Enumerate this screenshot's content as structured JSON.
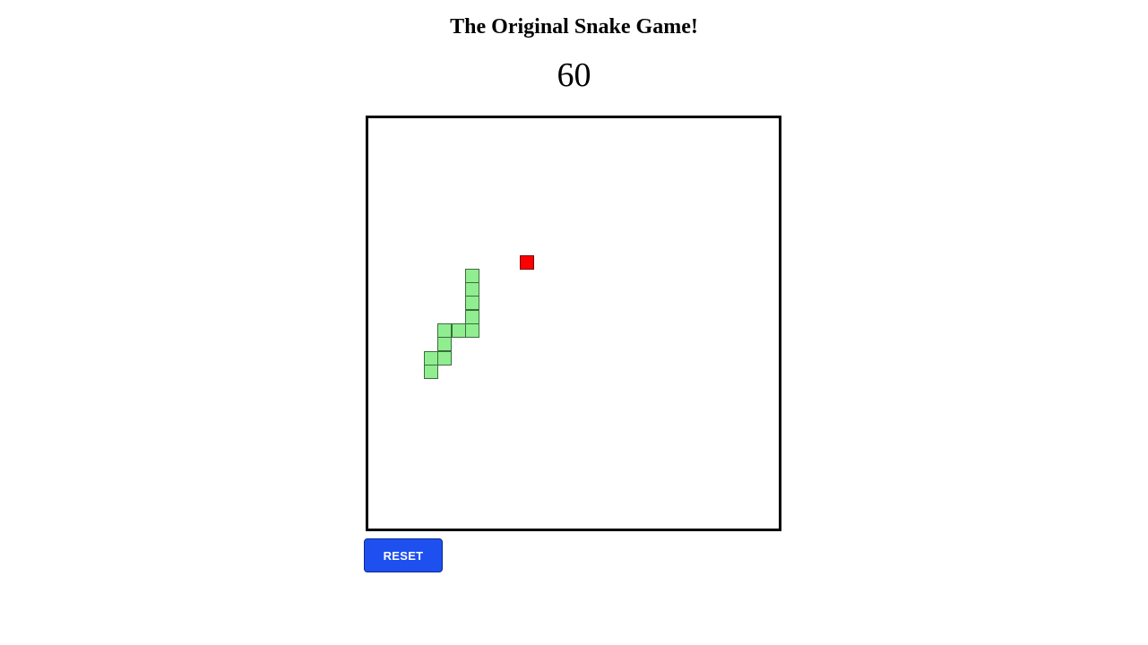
{
  "header": {
    "title": "The Original Snake Game!"
  },
  "score": "60",
  "board": {
    "grid_columns": 30,
    "grid_rows": 30,
    "snake_color": "#90ee90",
    "food_color": "#ff0000",
    "snake": [
      {
        "col": 7,
        "row": 11
      },
      {
        "col": 7,
        "row": 12
      },
      {
        "col": 7,
        "row": 13
      },
      {
        "col": 7,
        "row": 14
      },
      {
        "col": 7,
        "row": 15
      },
      {
        "col": 6,
        "row": 15
      },
      {
        "col": 5,
        "row": 15
      },
      {
        "col": 5,
        "row": 16
      },
      {
        "col": 5,
        "row": 17
      },
      {
        "col": 4,
        "row": 17
      },
      {
        "col": 4,
        "row": 18
      }
    ],
    "food": {
      "col": 11,
      "row": 10
    }
  },
  "controls": {
    "reset_label": "RESET"
  }
}
